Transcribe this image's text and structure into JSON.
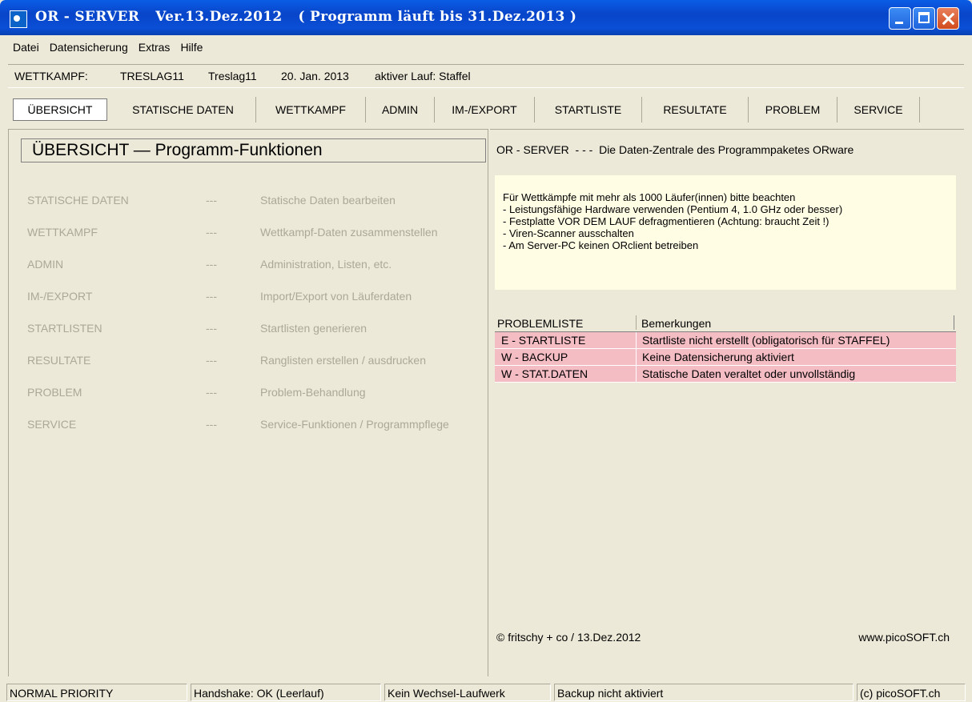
{
  "window": {
    "title_app": "OR - SERVER",
    "title_version": "Ver.13.Dez.2012",
    "title_license": "( Programm läuft bis 31.Dez.2013 )"
  },
  "menu": [
    "Datei",
    "Datensicherung",
    "Extras",
    "Hilfe"
  ],
  "info": {
    "label": "WETTKAMPF:",
    "code": "TRESLAG11",
    "name": "Treslag11",
    "date": "20. Jan. 2013",
    "run": "aktiver Lauf: Staffel"
  },
  "tabs": [
    "ÜBERSICHT",
    "STATISCHE DATEN",
    "WETTKAMPF",
    "ADMIN",
    "IM-/EXPORT",
    "STARTLISTE",
    "RESULTATE",
    "PROBLEM",
    "SERVICE"
  ],
  "left": {
    "title": "ÜBERSICHT — Programm-Funktionen",
    "functions": [
      {
        "name": "STATISCHE DATEN",
        "sep": "---",
        "desc": "Statische Daten bearbeiten"
      },
      {
        "name": "WETTKAMPF",
        "sep": "---",
        "desc": "Wettkampf-Daten zusammenstellen"
      },
      {
        "name": "ADMIN",
        "sep": "---",
        "desc": "Administration, Listen, etc."
      },
      {
        "name": "IM-/EXPORT",
        "sep": "---",
        "desc": "Import/Export von Läuferdaten"
      },
      {
        "name": "STARTLISTEN",
        "sep": "---",
        "desc": "Startlisten generieren"
      },
      {
        "name": "RESULTATE",
        "sep": "---",
        "desc": "Ranglisten erstellen / ausdrucken"
      },
      {
        "name": "PROBLEM",
        "sep": "---",
        "desc": "Problem-Behandlung"
      },
      {
        "name": "SERVICE",
        "sep": "---",
        "desc": "Service-Funktionen / Programmpflege"
      }
    ]
  },
  "right": {
    "header": "OR - SERVER  - - -  Die Daten-Zentrale des Programmpaketes ORware",
    "notice": [
      "Für Wettkämpfe mit mehr als 1000 Läufer(innen) bitte beachten",
      "- Leistungsfähige Hardware verwenden (Pentium 4, 1.0 GHz oder besser)",
      "- Festplatte VOR DEM LAUF defragmentieren (Achtung: braucht Zeit !)",
      "- Viren-Scanner ausschalten",
      "- Am Server-PC keinen ORclient betreiben"
    ],
    "problems": {
      "col1": "PROBLEMLISTE",
      "col2": "Bemerkungen",
      "rows": [
        {
          "code": "E - STARTLISTE",
          "remark": "Startliste nicht erstellt (obligatorisch für STAFFEL)"
        },
        {
          "code": "W - BACKUP",
          "remark": "Keine Datensicherung aktiviert"
        },
        {
          "code": "W - STAT.DATEN",
          "remark": "Statische Daten veraltet oder unvollständig"
        }
      ]
    },
    "footer_left": "© fritschy + co / 13.Dez.2012",
    "footer_right": "www.picoSOFT.ch"
  },
  "status": [
    "NORMAL PRIORITY",
    "Handshake: OK (Leerlauf)",
    "Kein Wechsel-Laufwerk",
    "Backup nicht aktiviert",
    "(c) picoSOFT.ch"
  ],
  "colors": {
    "titlebar": "#0a5de6",
    "background": "#ece9d8",
    "notice_bg": "#fffde4",
    "problem_row": "#f4bcc3",
    "function_text": "#aca899"
  }
}
